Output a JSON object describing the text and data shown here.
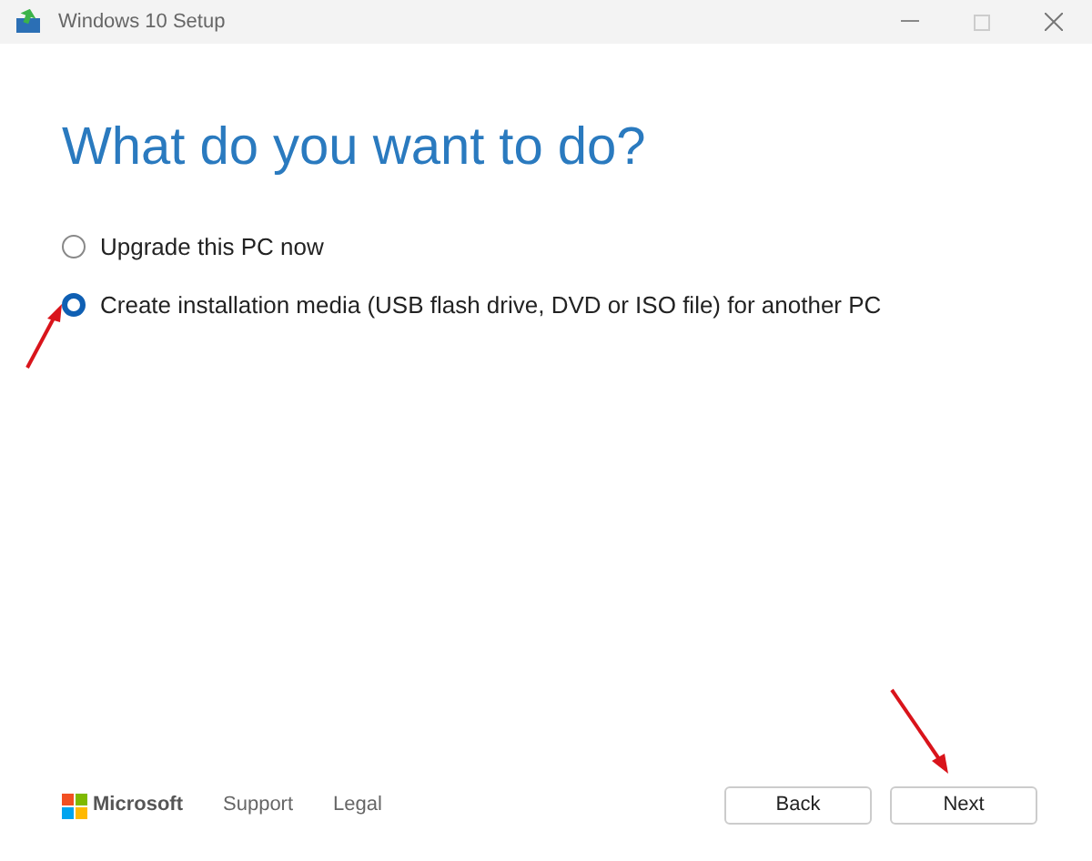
{
  "window": {
    "title": "Windows 10 Setup"
  },
  "heading": "What do you want to do?",
  "options": [
    {
      "label": "Upgrade this PC now",
      "selected": false
    },
    {
      "label": "Create installation media (USB flash drive, DVD or ISO file) for another PC",
      "selected": true
    }
  ],
  "footer": {
    "brand": "Microsoft",
    "links": [
      "Support",
      "Legal"
    ]
  },
  "buttons": [
    "Back",
    "Next"
  ]
}
